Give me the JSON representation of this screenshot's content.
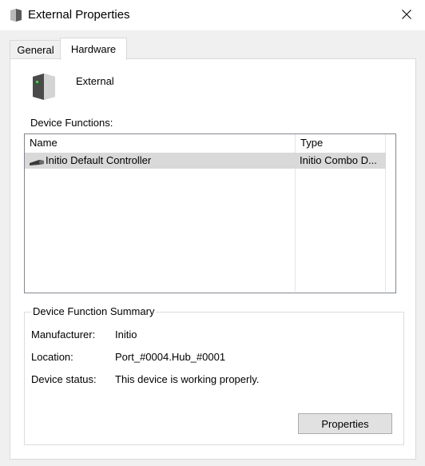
{
  "window": {
    "title": "External Properties",
    "title_icon": "drive-icon",
    "close_icon": "close-icon"
  },
  "tabs": [
    {
      "label": "General",
      "active": false
    },
    {
      "label": "Hardware",
      "active": true
    }
  ],
  "device": {
    "name": "External",
    "icon": "external-drive-icon"
  },
  "device_functions": {
    "label": "Device Functions:",
    "columns": [
      "Name",
      "Type"
    ],
    "rows": [
      {
        "icon": "usb-connector-icon",
        "name": "Initio Default Controller",
        "type": "Initio Combo D...",
        "selected": true
      }
    ]
  },
  "summary": {
    "title": "Device Function Summary",
    "manufacturer_label": "Manufacturer:",
    "manufacturer_value": "Initio",
    "location_label": "Location:",
    "location_value": "Port_#0004.Hub_#0001",
    "status_label": "Device status:",
    "status_value": "This device is working properly.",
    "properties_button": "Properties"
  },
  "colors": {
    "selection": "#d9d9d9",
    "window_bg": "#f0f0f0",
    "button_bg": "#e1e1e1"
  }
}
